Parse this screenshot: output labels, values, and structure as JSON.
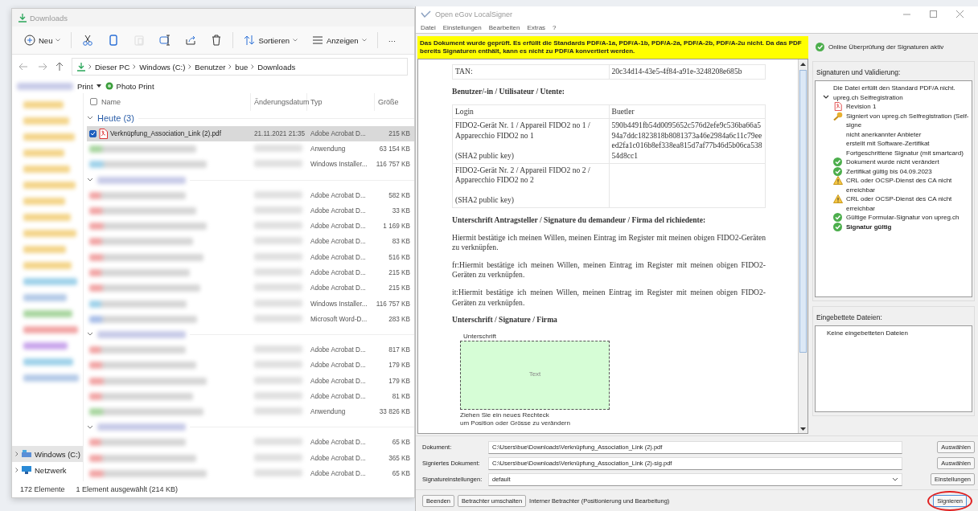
{
  "explorer": {
    "title": "Downloads",
    "toolbar": [
      {
        "kind": "new",
        "label": "Neu",
        "disabled": false
      },
      {
        "kind": "cut",
        "disabled": false
      },
      {
        "kind": "copy",
        "disabled": false
      },
      {
        "kind": "paste",
        "disabled": true
      },
      {
        "kind": "rename",
        "disabled": false
      },
      {
        "kind": "share",
        "disabled": false
      },
      {
        "kind": "delete",
        "disabled": false
      },
      {
        "kind": "sort",
        "label": "Sortieren",
        "disabled": false
      },
      {
        "kind": "view",
        "label": "Anzeigen",
        "disabled": false
      },
      {
        "kind": "more",
        "label": "···",
        "disabled": false
      }
    ],
    "breadcrumb": [
      "Dieser PC",
      "Windows (C:)",
      "Benutzer",
      "bue",
      "Downloads"
    ],
    "quickbar": [
      {
        "kind": "dropdown",
        "label": "Print"
      },
      {
        "kind": "app",
        "label": "Photo Print"
      }
    ],
    "select_all": {
      "checked": false
    },
    "columns": [
      "Name",
      "Änderungsdatum",
      "Typ",
      "Größe"
    ],
    "groups": [
      {
        "label": "Heute (3)",
        "rows": [
          {
            "kind": "pdf",
            "name": "Verknüpfung_Association_Link (2).pdf",
            "date": "21.11.2021 21:35",
            "type": "Adobe Acrobat D...",
            "size": "215 KB",
            "selected": true
          },
          {
            "kind": "app",
            "type": "Anwendung",
            "size": "63 154 KB",
            "selected": false
          },
          {
            "kind": "msi",
            "type": "Windows Installer...",
            "size": "116 757 KB",
            "selected": false
          }
        ]
      },
      {
        "rows": [
          {
            "kind": "pdf",
            "type": "Adobe Acrobat D...",
            "size": "582 KB",
            "selected": false
          },
          {
            "kind": "pdf",
            "type": "Adobe Acrobat D...",
            "size": "33 KB",
            "selected": false
          },
          {
            "kind": "pdf",
            "type": "Adobe Acrobat D...",
            "size": "1 169 KB",
            "selected": false
          },
          {
            "kind": "pdf",
            "type": "Adobe Acrobat D...",
            "size": "83 KB",
            "selected": false
          },
          {
            "kind": "pdf",
            "type": "Adobe Acrobat D...",
            "size": "516 KB",
            "selected": false
          },
          {
            "kind": "pdf",
            "type": "Adobe Acrobat D...",
            "size": "215 KB",
            "selected": false
          },
          {
            "kind": "pdf",
            "type": "Adobe Acrobat D...",
            "size": "215 KB",
            "selected": false
          },
          {
            "kind": "msi",
            "type": "Windows Installer...",
            "size": "116 757 KB",
            "selected": false
          },
          {
            "kind": "word",
            "type": "Microsoft Word-D...",
            "size": "283 KB",
            "selected": false
          }
        ]
      },
      {
        "rows": [
          {
            "kind": "pdf",
            "type": "Adobe Acrobat D...",
            "size": "817 KB",
            "selected": false
          },
          {
            "kind": "pdf",
            "type": "Adobe Acrobat D...",
            "size": "179 KB",
            "selected": false
          },
          {
            "kind": "pdf",
            "type": "Adobe Acrobat D...",
            "size": "179 KB",
            "selected": false
          },
          {
            "kind": "pdf",
            "type": "Adobe Acrobat D...",
            "size": "81 KB",
            "selected": false
          },
          {
            "kind": "app",
            "type": "Anwendung",
            "size": "33 826 KB",
            "selected": false
          }
        ]
      },
      {
        "rows": [
          {
            "kind": "pdf",
            "type": "Adobe Acrobat D...",
            "size": "65 KB",
            "selected": false
          },
          {
            "kind": "pdf",
            "type": "Adobe Acrobat D...",
            "size": "365 KB",
            "selected": false
          },
          {
            "kind": "pdf",
            "type": "Adobe Acrobat D...",
            "size": "65 KB",
            "selected": false
          }
        ]
      }
    ],
    "sidebar": [
      {
        "kind": "drive",
        "label": "Windows (C:)",
        "selected": true
      },
      {
        "kind": "network",
        "label": "Netzwerk",
        "selected": false
      }
    ],
    "status": [
      "172 Elemente",
      "1 Element ausgewählt (214 KB)"
    ]
  },
  "signer": {
    "title": "Open eGov LocalSigner",
    "menu": [
      "Datei",
      "Einstellungen",
      "Bearbeiten",
      "Extras",
      "?"
    ],
    "banner": "Das Dokument wurde geprüft. Es erfüllt die Standards PDF/A-1a, PDF/A-1b, PDF/A-2a, PDF/A-2b, PDF/A-2u nicht. Da das PDF bereits Signaturen enthält, kann es nicht zu PDF/A konvertiert werden.",
    "document": [
      {
        "kind": "table",
        "rows": [
          [
            "TAN:",
            "20c34d14-43e5-4f84-a91e-3248208e685b"
          ]
        ]
      },
      {
        "kind": "heading",
        "text": "Benutzer/-in / Utilisateur / Utente:"
      },
      {
        "kind": "table",
        "rows": [
          [
            "Login",
            "Buetler"
          ],
          [
            "FIDO2-Gerät Nr. 1 / Appareil FIDO2 no 1 / Apparecchio FIDO2 no 1\n\n(SHA2 public key)",
            "590b4491fb54d0095652c576d2efe9c536ba66a594a7ddc1823818b8081373a46e2984a6c11c79eeed2fa1c016b8ef338ea815d7af77b46d5b06ca53854d8cc1"
          ],
          [
            "FIDO2-Gerät Nr. 2 / Appareil FIDO2 no 2 / Apparecchio FIDO2 no 2\n\n(SHA2 public key)",
            ""
          ]
        ]
      },
      {
        "kind": "heading",
        "text": "Unterschrift Antragsteller / Signature du demandeur / Firma del richiedente:"
      },
      {
        "kind": "paragraph",
        "text": "Hiermit bestätige ich meinen Willen, meinen Eintrag im Register mit meinen obigen FIDO2-Geräten zu verknüpfen."
      },
      {
        "kind": "paragraph",
        "text": "fr:Hiermit bestätige ich meinen Willen, meinen Eintrag im Register mit meinen obigen FIDO2-Geräten zu verknüpfen."
      },
      {
        "kind": "paragraph",
        "text": "it:Hiermit bestätige ich meinen Willen, meinen Eintrag im Register mit meinen obigen FIDO2-Geräten zu verknüpfen."
      },
      {
        "kind": "heading",
        "text": "Unterschrift / Signature / Firma"
      },
      {
        "kind": "signature",
        "label": "Unterschrift",
        "text": "Text",
        "hint": "Ziehen Sie ein neues Rechteck\num Position oder Grösse zu verändern"
      }
    ],
    "online_status": "Online Überprüfung der Signaturen aktiv",
    "signatures_heading": "Signaturen und Validierung:",
    "tree": [
      {
        "text": "Die Datei erfüllt den Standard PDF/A nicht."
      },
      {
        "text": "upreg.ch Selfregistration",
        "expanded": true,
        "children": [
          {
            "kind": "pdf",
            "text": "Revision 1",
            "bold": false
          },
          {
            "kind": "key",
            "text": "Signiert von upreg.ch Selfregistration (Self-signe",
            "bold": false
          },
          {
            "kind": "none",
            "text": "nicht anerkannter Anbieter",
            "bold": false
          },
          {
            "kind": "none",
            "text": "erstellt mit Software-Zertifikat",
            "bold": false
          },
          {
            "kind": "none",
            "text": "Fortgeschrittene Signatur (mit smartcard)",
            "bold": false
          },
          {
            "kind": "ok",
            "text": "Dokument wurde nicht verändert",
            "bold": false
          },
          {
            "kind": "ok",
            "text": "Zertifikat gültig bis 04.09.2023",
            "bold": false
          },
          {
            "kind": "warn",
            "text": "CRL oder OCSP-Dienst des CA nicht erreichbar",
            "bold": false
          },
          {
            "kind": "warn",
            "text": "CRL oder OCSP-Dienst des CA nicht erreichbar",
            "bold": false
          },
          {
            "kind": "ok",
            "text": "Gültige Formular-Signatur von upreg.ch",
            "bold": false
          },
          {
            "kind": "ok",
            "text": "Signatur gültig",
            "bold": true
          }
        ]
      }
    ],
    "embedded_heading": "Eingebettete Dateien:",
    "embedded": [
      "Keine eingebetteten Dateien"
    ],
    "fields": [
      {
        "kind": "text",
        "label": "Dokument:",
        "value": "C:\\Users\\bue\\Downloads\\Verknüpfung_Association_Link (2).pdf",
        "button": "Auswählen"
      },
      {
        "kind": "text",
        "label": "Signiertes Dokument:",
        "value": "C:\\Users\\bue\\Downloads\\Verknüpfung_Association_Link (2)-sig.pdf",
        "button": "Auswählen"
      },
      {
        "kind": "select",
        "label": "Signatureinstellungen:",
        "value": "default",
        "button": "Einstellungen"
      }
    ],
    "buttons": [
      "Beenden",
      "Betrachter umschalten"
    ],
    "viewer_info": "Interner Betrachter (Positionierung und Bearbeitung)",
    "sign_button": {
      "label": "Signieren",
      "circled": true
    }
  }
}
